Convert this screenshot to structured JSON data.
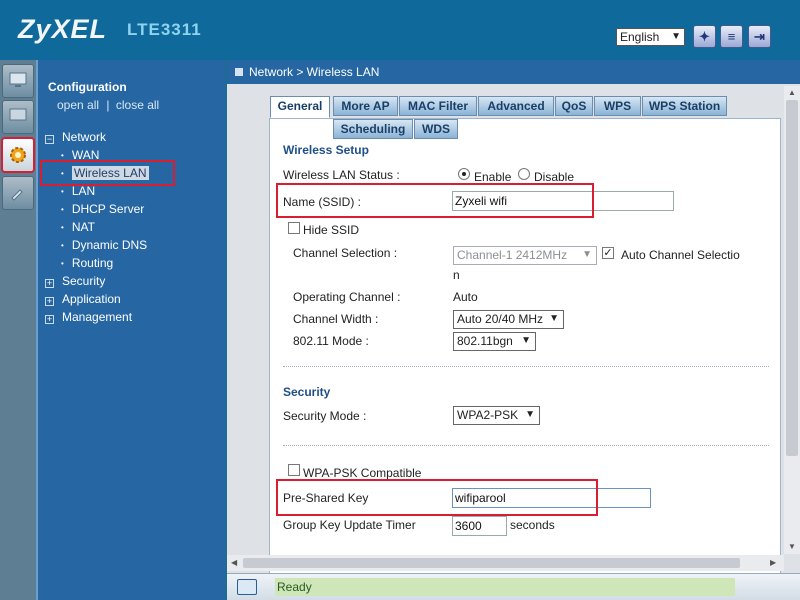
{
  "header": {
    "brand": "ZyXEL",
    "model": "LTE3311",
    "language": "English"
  },
  "nav": {
    "title": "Configuration",
    "open_all": "open all",
    "separator": "|",
    "close_all": "close all",
    "network": "Network",
    "network_items": [
      "WAN",
      "Wireless LAN",
      "LAN",
      "DHCP Server",
      "NAT",
      "Dynamic DNS",
      "Routing"
    ],
    "security": "Security",
    "application": "Application",
    "management": "Management"
  },
  "breadcrumb": "Network > Wireless LAN",
  "tabs": {
    "row1": [
      "General",
      "More AP",
      "MAC Filter",
      "Advanced",
      "QoS",
      "WPS",
      "WPS Station"
    ],
    "row2": [
      "Scheduling",
      "WDS"
    ]
  },
  "wireless_setup": {
    "title": "Wireless Setup",
    "status_label": "Wireless LAN Status :",
    "enable": "Enable",
    "disable": "Disable",
    "ssid_label": "Name (SSID) :",
    "ssid_value": "Zyxeli wifi",
    "hide_ssid": "Hide SSID",
    "channel_selection_label": "Channel Selection :",
    "channel_selection_value": "Channel-1 2412MHz",
    "auto_channel_line1": "Auto Channel Selectio",
    "auto_channel_line2": "n",
    "operating_channel_label": "Operating Channel :",
    "operating_channel_value": "Auto",
    "channel_width_label": "Channel Width :",
    "channel_width_value": "Auto 20/40 MHz",
    "mode_label": "802.11 Mode :",
    "mode_value": "802.11bgn"
  },
  "security": {
    "title": "Security",
    "mode_label": "Security Mode :",
    "mode_value": "WPA2-PSK",
    "wpa_compat": "WPA-PSK Compatible",
    "psk_label": "Pre-Shared Key",
    "psk_value": "wifiparool",
    "group_key_label": "Group Key Update Timer",
    "group_key_value": "3600",
    "group_key_unit": "seconds"
  },
  "status": "Ready"
}
